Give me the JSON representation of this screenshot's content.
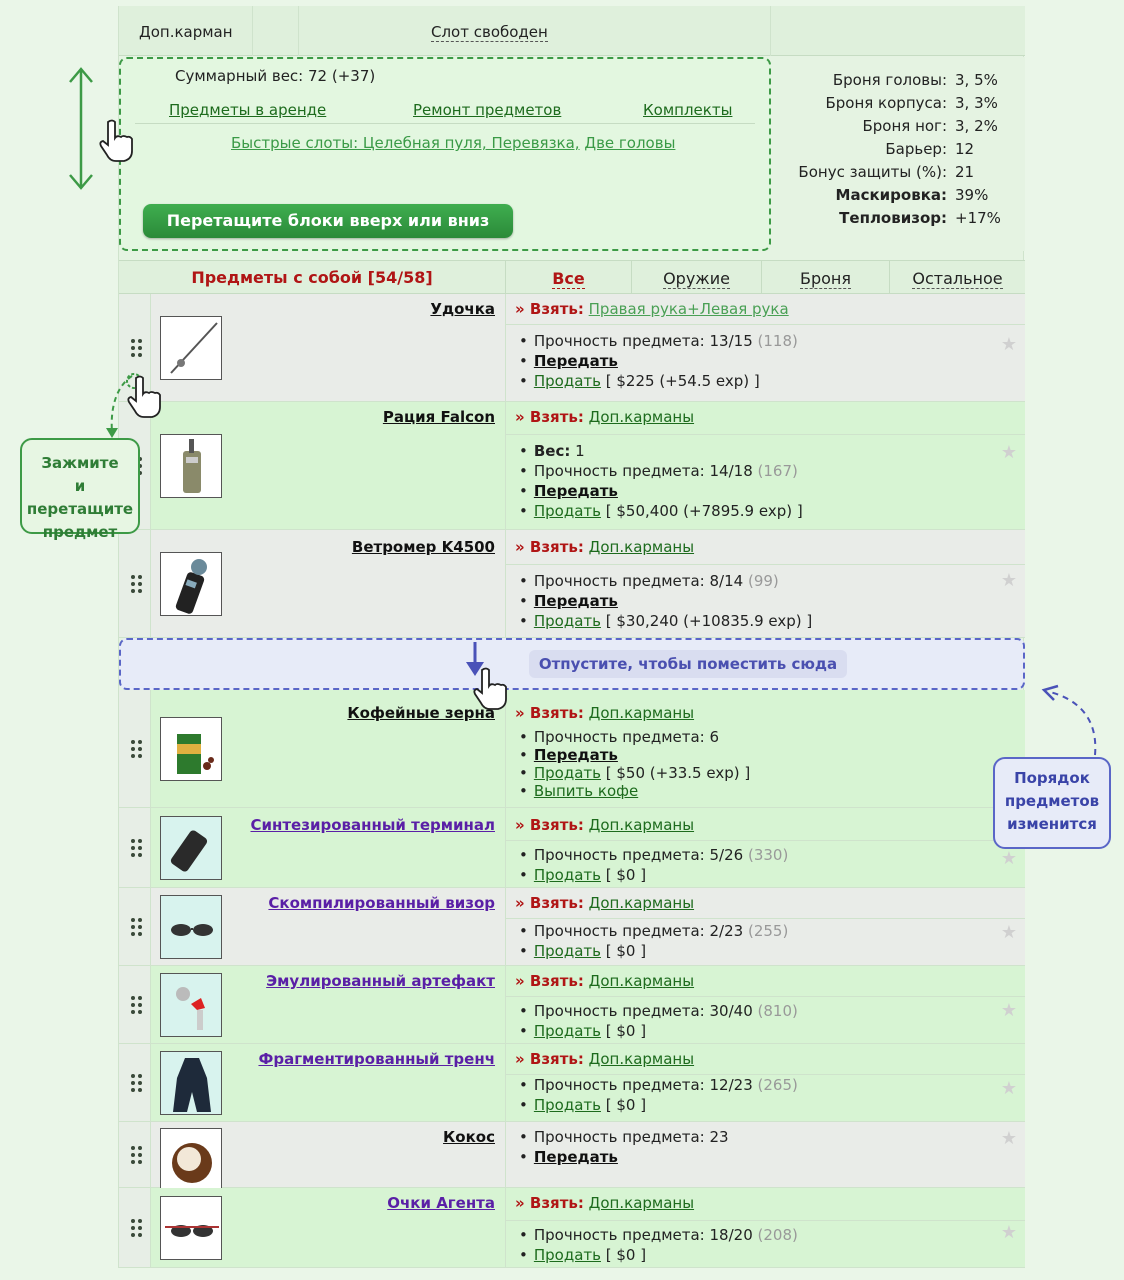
{
  "slot": {
    "label": "Доп.карман",
    "status": "Слот свободен"
  },
  "info": {
    "weight": "Суммарный вес: 72 (+37)",
    "links": [
      "Предметы в аренде",
      "Ремонт предметов",
      "Комплекты"
    ],
    "quick_slots": "Быстрые слоты: Целебная пуля, Перевязка,",
    "quick_slots_extra": "Две головы",
    "drag_button": "Перетащите блоки вверх или вниз"
  },
  "stats": [
    {
      "k": "Броня головы:",
      "v": "3, 5%",
      "bold": false
    },
    {
      "k": "Броня корпуса:",
      "v": "3, 3%",
      "bold": false
    },
    {
      "k": "Броня ног:",
      "v": "3, 2%",
      "bold": false
    },
    {
      "k": "Барьер:",
      "v": "12",
      "bold": false
    },
    {
      "k": "Бонус защиты (%):",
      "v": "21",
      "bold": false
    },
    {
      "k": "Маскировка:",
      "v": "39%",
      "bold": true
    },
    {
      "k": "Тепловизор:",
      "v": "+17%",
      "bold": true
    }
  ],
  "items_header": {
    "title": "Предметы с собой [54/58]",
    "tabs": [
      "Все",
      "Оружие",
      "Броня",
      "Остальное"
    ]
  },
  "common": {
    "take": "» Взять:",
    "pass": "Передать",
    "sell": "Продать",
    "durability": "Прочность предмета:",
    "weight": "Вес:",
    "star": "★"
  },
  "items": [
    {
      "name": "Удочка",
      "take": "Правая рука+Левая рука",
      "durability": "13/15",
      "dur_extra": "(118)",
      "price": "[ $225 (+54.5 exp) ]"
    },
    {
      "name": "Рация Falcon",
      "take": "Доп.карманы",
      "weight": "1",
      "durability": "14/18",
      "dur_extra": "(167)",
      "price": "[ $50,400 (+7895.9 exp) ]"
    },
    {
      "name": "Ветромер K4500",
      "take": "Доп.карманы",
      "durability": "8/14",
      "dur_extra": "(99)",
      "price": "[ $30,240 (+10835.9 exp) ]"
    },
    {
      "name": "Кофейные зерна",
      "take": "Доп.карманы",
      "durability": "6",
      "price": "[ $50 (+33.5 exp) ]",
      "extra_action": "Выпить кофе"
    },
    {
      "name": "Синтезированный терминал",
      "take": "Доп.карманы",
      "durability": "5/26",
      "dur_extra": "(330)",
      "price": "[ $0 ]"
    },
    {
      "name": "Скомпилированный визор",
      "take": "Доп.карманы",
      "durability": "2/23",
      "dur_extra": "(255)",
      "price": "[ $0 ]"
    },
    {
      "name": "Эмулированный артефакт",
      "take": "Доп.карманы",
      "durability": "30/40",
      "dur_extra": "(810)",
      "price": "[ $0 ]"
    },
    {
      "name": "Фрагментированный тренч",
      "take": "Доп.карманы",
      "durability": "12/23",
      "dur_extra": "(265)",
      "price": "[ $0 ]"
    },
    {
      "name": "Кокос",
      "durability": "23"
    },
    {
      "name": "Очки Агента",
      "take": "Доп.карманы",
      "durability": "18/20",
      "dur_extra": "(208)",
      "price": "[ $0 ]"
    }
  ],
  "drop_zone": "Отпустите, чтобы поместить сюда",
  "callouts": {
    "hold_line1": "Зажмите",
    "hold_line2": "и перетащите",
    "hold_line3": "предмет",
    "order_line1": "Порядок",
    "order_line2": "предметов",
    "order_line3": "изменится"
  },
  "colors": {
    "accent_green": "#3d9a46",
    "accent_red": "#b01515",
    "drop_blue": "#5a66c7",
    "purple_link": "#5a1fa6"
  }
}
